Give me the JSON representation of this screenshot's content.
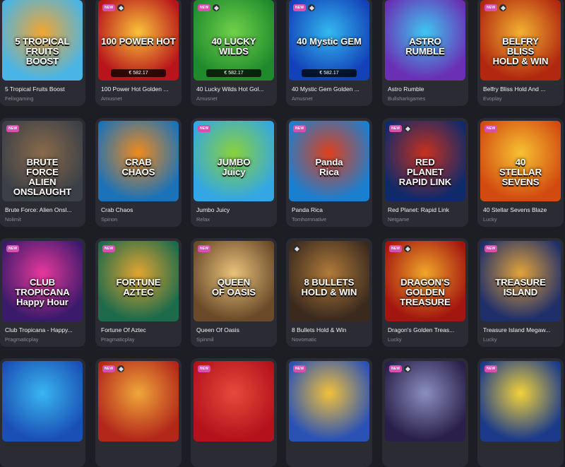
{
  "cards": [
    {
      "title": "5 Tropical Fruits Boost",
      "provider": "Felixgaming",
      "art": "5 TROPICAL\nFRUITS\nBOOST",
      "new": false,
      "icon": false,
      "price": "",
      "colors": [
        "#49b5e6",
        "#f2a531"
      ]
    },
    {
      "title": "100 Power Hot Golden ...",
      "provider": "Amusnet",
      "art": "100 POWER HOT",
      "new": true,
      "icon": true,
      "price": "€ 582.17",
      "colors": [
        "#b8141b",
        "#f9c33a"
      ]
    },
    {
      "title": "40 Lucky Wilds Hot Gol...",
      "provider": "Amusnet",
      "art": "40 LUCKY WILDS",
      "new": true,
      "icon": true,
      "price": "€ 582.17",
      "colors": [
        "#1f8a2c",
        "#6fd14a"
      ]
    },
    {
      "title": "40 Mystic Gem Golden ...",
      "provider": "Amusnet",
      "art": "40 Mystic GEM",
      "new": true,
      "icon": true,
      "price": "€ 582.17",
      "colors": [
        "#1341b8",
        "#33b9f0"
      ]
    },
    {
      "title": "Astro Rumble",
      "provider": "Bullsharkgames",
      "art": "ASTRO\nRUMBLE",
      "new": false,
      "icon": false,
      "price": "",
      "colors": [
        "#6a2fb5",
        "#3ec7f0"
      ]
    },
    {
      "title": "Belfry Bliss Hold And ...",
      "provider": "Evoplay",
      "art": "BELFRY\nBLISS\nHOLD & WIN",
      "new": true,
      "icon": true,
      "price": "",
      "colors": [
        "#b1270f",
        "#f2b132"
      ]
    },
    {
      "title": "Brute Force: Alien Onsl...",
      "provider": "Nolimit",
      "art": "BRUTE\nFORCE\nALIEN ONSLAUGHT",
      "new": true,
      "icon": false,
      "price": "",
      "colors": [
        "#3b4048",
        "#8a6a4a"
      ]
    },
    {
      "title": "Crab Chaos",
      "provider": "Spinon",
      "art": "CRAB\nCHAOS",
      "new": false,
      "icon": false,
      "price": "",
      "colors": [
        "#1b72b8",
        "#f08a1c"
      ]
    },
    {
      "title": "Jumbo Juicy",
      "provider": "Relax",
      "art": "JUMBO\nJuicy",
      "new": true,
      "icon": false,
      "price": "",
      "colors": [
        "#33a7e3",
        "#8ad13a"
      ]
    },
    {
      "title": "Panda Rica",
      "provider": "Tomhornnative",
      "art": "Panda\nRica",
      "new": true,
      "icon": false,
      "price": "",
      "colors": [
        "#1b7fd0",
        "#e0401b"
      ]
    },
    {
      "title": "Red Planet: Rapid Link",
      "provider": "Netgame",
      "art": "RED\nPLANET\nRAPID LINK",
      "new": true,
      "icon": true,
      "price": "",
      "colors": [
        "#0f2a6a",
        "#c8301e"
      ]
    },
    {
      "title": "40 Stellar Sevens Blaze",
      "provider": "Lucky",
      "art": "40\nSTELLAR SEVENS",
      "new": true,
      "icon": false,
      "price": "",
      "colors": [
        "#d24a10",
        "#f7c232"
      ]
    },
    {
      "title": "Club Tropicana - Happy...",
      "provider": "Pragmaticplay",
      "art": "CLUB TROPICANA\nHappy Hour",
      "new": true,
      "icon": false,
      "price": "",
      "colors": [
        "#3a1a6b",
        "#e8389b"
      ]
    },
    {
      "title": "Fortune Of Aztec",
      "provider": "Pragmaticplay",
      "art": "FORTUNE\nAZTEC",
      "new": true,
      "icon": false,
      "price": "",
      "colors": [
        "#1d6b4b",
        "#e2a431"
      ]
    },
    {
      "title": "Queen Of Oasis",
      "provider": "Spinmil",
      "art": "QUEEN\nOF OASIS",
      "new": true,
      "icon": false,
      "price": "",
      "colors": [
        "#6b4a2a",
        "#e8c27a"
      ]
    },
    {
      "title": "8 Bullets Hold & Win",
      "provider": "Novomatic",
      "art": "8 BULLETS\nHOLD & WIN",
      "new": false,
      "icon": true,
      "price": "",
      "colors": [
        "#3a2a1e",
        "#b07a3a"
      ]
    },
    {
      "title": "Dragon's Golden Treas...",
      "provider": "Lucky",
      "art": "DRAGON'S\nGOLDEN TREASURE",
      "new": true,
      "icon": true,
      "price": "",
      "colors": [
        "#a3150f",
        "#f0a62a"
      ]
    },
    {
      "title": "Treasure Island Megaw...",
      "provider": "Lucky",
      "art": "TREASURE\nISLAND",
      "new": true,
      "icon": false,
      "price": "",
      "colors": [
        "#1f2f6a",
        "#e2a23a"
      ]
    },
    {
      "title": "",
      "provider": "",
      "art": "",
      "new": false,
      "icon": false,
      "price": "",
      "colors": [
        "#1a4fb5",
        "#39b6f0"
      ]
    },
    {
      "title": "",
      "provider": "",
      "art": "",
      "new": true,
      "icon": true,
      "price": "",
      "colors": [
        "#b3271a",
        "#f0a63a"
      ]
    },
    {
      "title": "",
      "provider": "",
      "art": "",
      "new": true,
      "icon": false,
      "price": "",
      "colors": [
        "#b3121c",
        "#e64a3a"
      ]
    },
    {
      "title": "",
      "provider": "",
      "art": "",
      "new": true,
      "icon": false,
      "price": "",
      "colors": [
        "#2a52b5",
        "#f2c13a"
      ]
    },
    {
      "title": "",
      "provider": "",
      "art": "",
      "new": true,
      "icon": true,
      "price": "",
      "colors": [
        "#2a1f4a",
        "#8a8fc0"
      ]
    },
    {
      "title": "",
      "provider": "",
      "art": "",
      "new": true,
      "icon": false,
      "price": "",
      "colors": [
        "#1b3a8a",
        "#f2d23a"
      ]
    }
  ],
  "badge_new_label": "NEW"
}
